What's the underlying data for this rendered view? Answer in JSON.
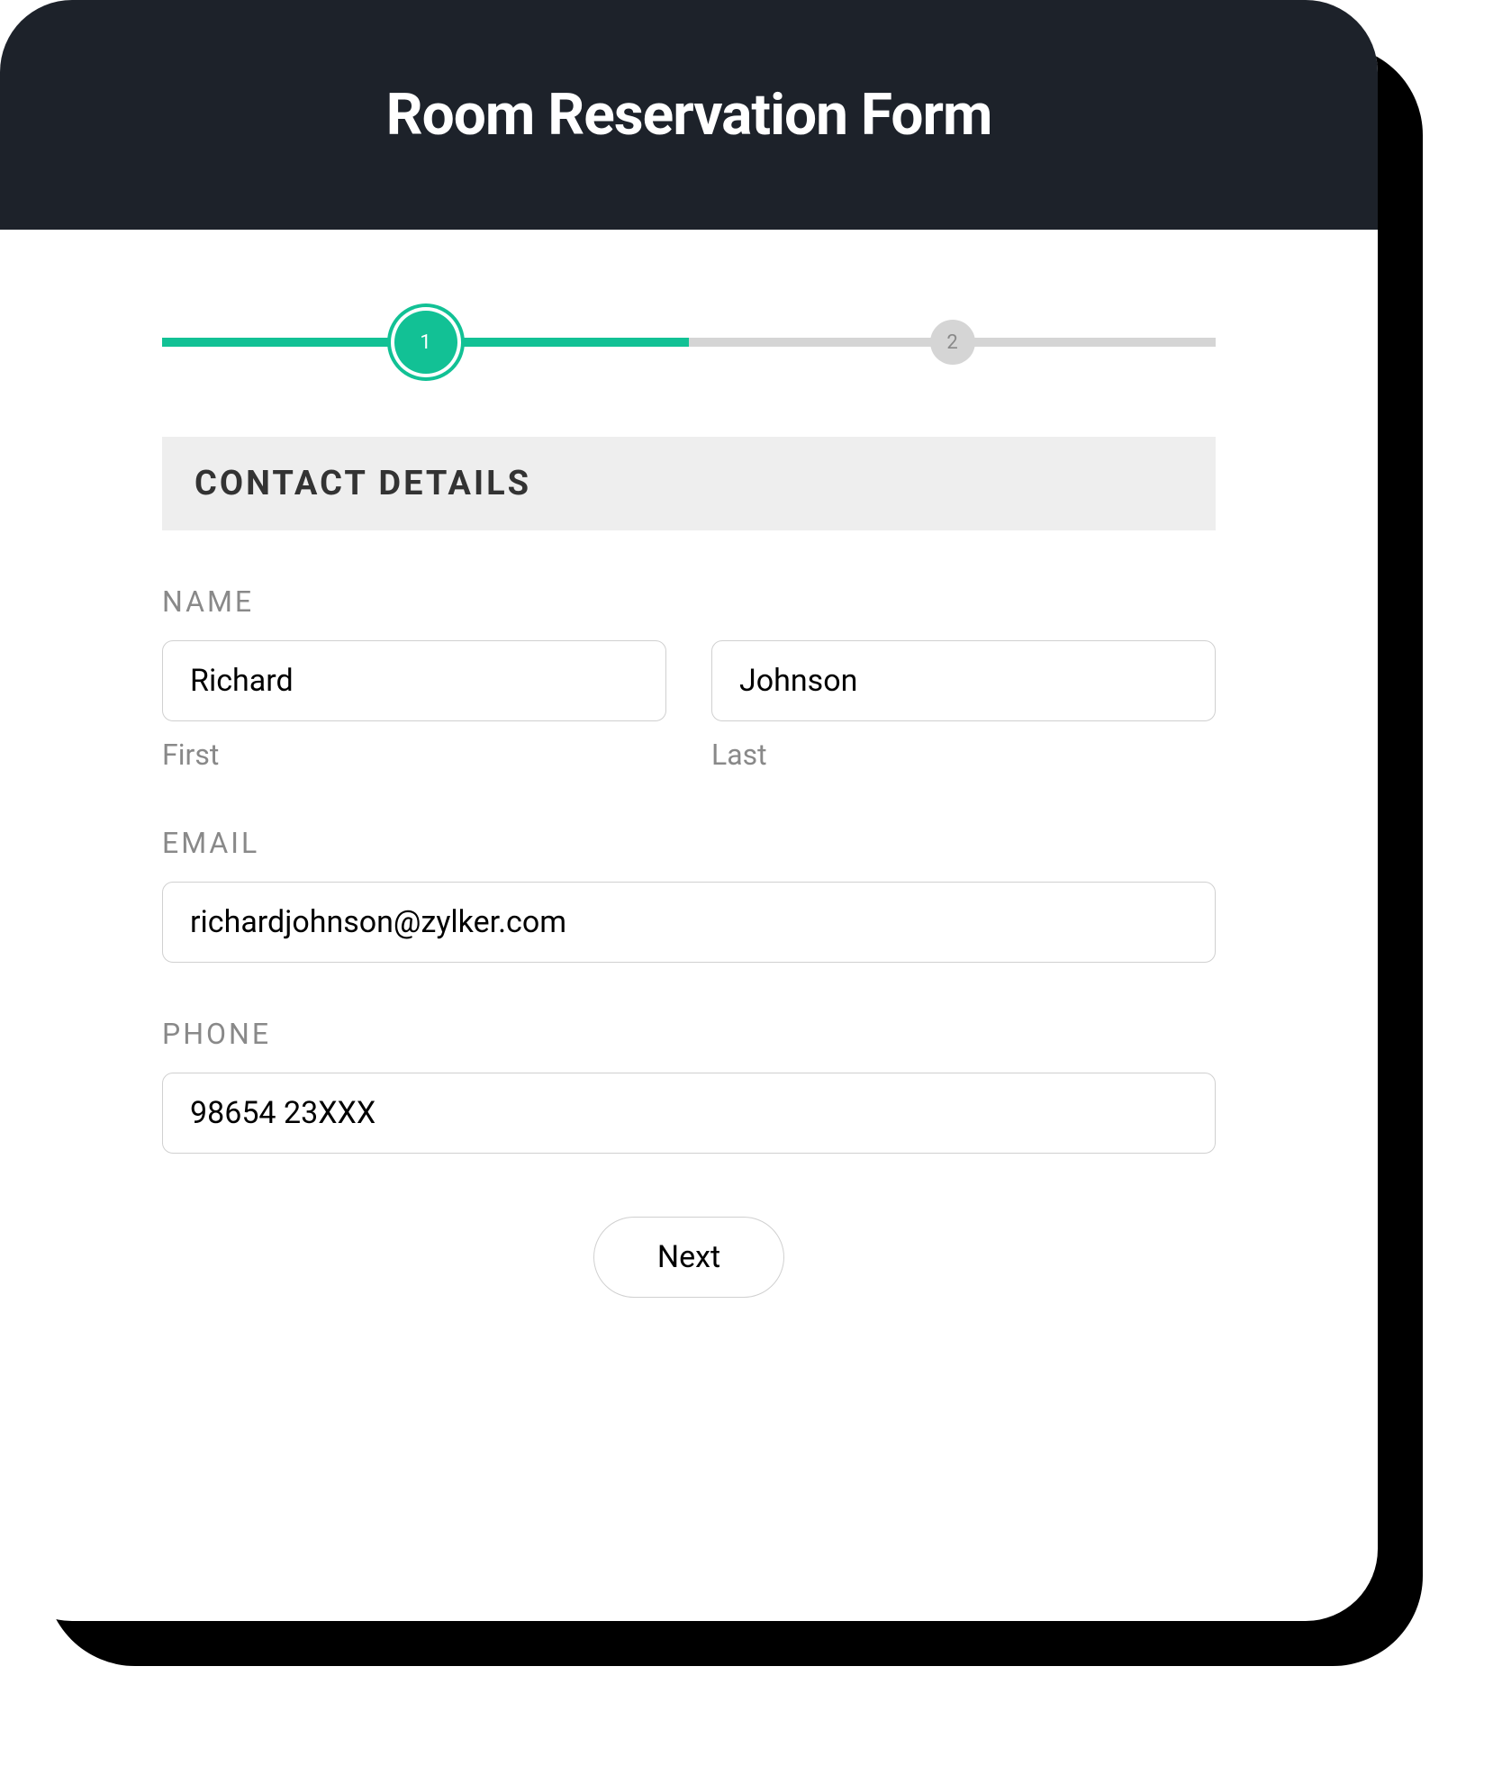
{
  "header": {
    "title": "Room Reservation Form"
  },
  "progress": {
    "steps": [
      {
        "number": "1",
        "active": true
      },
      {
        "number": "2",
        "active": false
      }
    ]
  },
  "section": {
    "title": "CONTACT DETAILS"
  },
  "fields": {
    "name": {
      "label": "NAME",
      "first": {
        "value": "Richard",
        "sublabel": "First"
      },
      "last": {
        "value": "Johnson",
        "sublabel": "Last"
      }
    },
    "email": {
      "label": "EMAIL",
      "value": "richardjohnson@zylker.com"
    },
    "phone": {
      "label": "PHONE",
      "value": "98654 23XXX"
    }
  },
  "buttons": {
    "next": "Next"
  }
}
